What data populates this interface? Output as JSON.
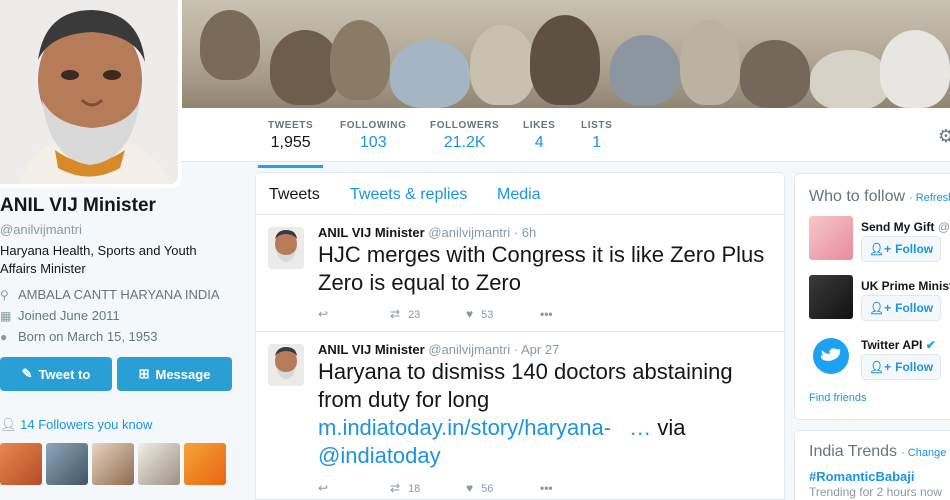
{
  "colors": {
    "accent": "#1da1f2",
    "link": "#1b95e0",
    "button_blue": "#2a9fd6"
  },
  "profile": {
    "name": "ANIL VIJ Minister",
    "handle": "@anilvijmantri",
    "bio": "Haryana Health, Sports and Youth Affairs Minister",
    "location": "AMBALA CANTT HARYANA INDIA",
    "joined": "Joined June 2011",
    "born": "Born on March 15, 1953",
    "tweet_to_label": "Tweet to",
    "message_label": "Message",
    "followers_you_know": "14 Followers you know"
  },
  "nav": {
    "tweets": {
      "label": "TWEETS",
      "value": "1,955"
    },
    "following": {
      "label": "FOLLOWING",
      "value": "103"
    },
    "followers": {
      "label": "FOLLOWERS",
      "value": "21.2K"
    },
    "likes": {
      "label": "LIKES",
      "value": "4"
    },
    "lists": {
      "label": "LISTS",
      "value": "1"
    }
  },
  "timeline": {
    "tabs": [
      "Tweets",
      "Tweets & replies",
      "Media"
    ],
    "tweets": [
      {
        "author": "ANIL VIJ Minister",
        "handle": "@anilvijmantri",
        "time": "6h",
        "text": "HJC merges with Congress it is like Zero Plus Zero is equal to Zero",
        "retweets": "23",
        "likes": "53"
      },
      {
        "author": "ANIL VIJ Minister",
        "handle": "@anilvijmantri",
        "time": "Apr 27",
        "text": "Haryana to dismiss 140 doctors abstaining from duty for long",
        "link": "m.indiatoday.in/story/haryana-",
        "ellipsis": "…",
        "via": "via",
        "mention": "@indiatoday",
        "retweets": "18",
        "likes": "56"
      }
    ]
  },
  "who_to_follow": {
    "title": "Who to follow",
    "refresh": "· Refresh",
    "follow_label": "Follow",
    "suggestions": [
      {
        "name": "Send My Gift",
        "handle": "@S"
      },
      {
        "name": "UK Prime Minist"
      },
      {
        "name": "Twitter API"
      }
    ],
    "find_friends": "Find friends"
  },
  "trends": {
    "title": "India Trends",
    "change": "· Change",
    "items": [
      {
        "tag": "#RomanticBabaji",
        "sub": "Trending for 2 hours now"
      }
    ]
  }
}
